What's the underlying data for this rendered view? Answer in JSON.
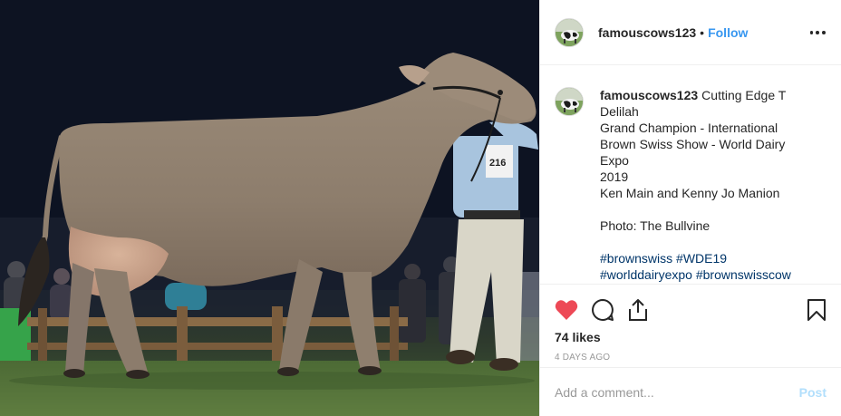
{
  "post": {
    "image_alt": "Brown Swiss cow in show ring",
    "show_number": "216"
  },
  "header": {
    "avatar_icon": "cow-avatar-icon",
    "username": "famouscows123",
    "separator": "•",
    "follow_label": "Follow",
    "more_icon": "more-options-icon"
  },
  "caption": {
    "username": "famouscows123",
    "lines": [
      "Cutting Edge T",
      "Delilah",
      "Grand Champion - International",
      "Brown Swiss Show - World Dairy Expo",
      "2019",
      "Ken Main and Kenny Jo Manion",
      "",
      "Photo: The Bullvine",
      ""
    ],
    "hashtags_line1": [
      "#brownswiss",
      "#WDE19"
    ],
    "hashtags_line2": [
      "#worlddairyexpo",
      "#brownswisscow"
    ]
  },
  "actions": {
    "like_icon": "heart-icon",
    "like_color": "#ed4956",
    "comment_icon": "comment-icon",
    "share_icon": "share-icon",
    "save_icon": "bookmark-icon"
  },
  "likes": "74 likes",
  "timestamp": "4 DAYS AGO",
  "comment": {
    "placeholder": "Add a comment...",
    "post_label": "Post"
  },
  "colors": {
    "link_blue": "#3897f0",
    "hashtag": "#003569",
    "post_disabled": "#b2dffc"
  }
}
